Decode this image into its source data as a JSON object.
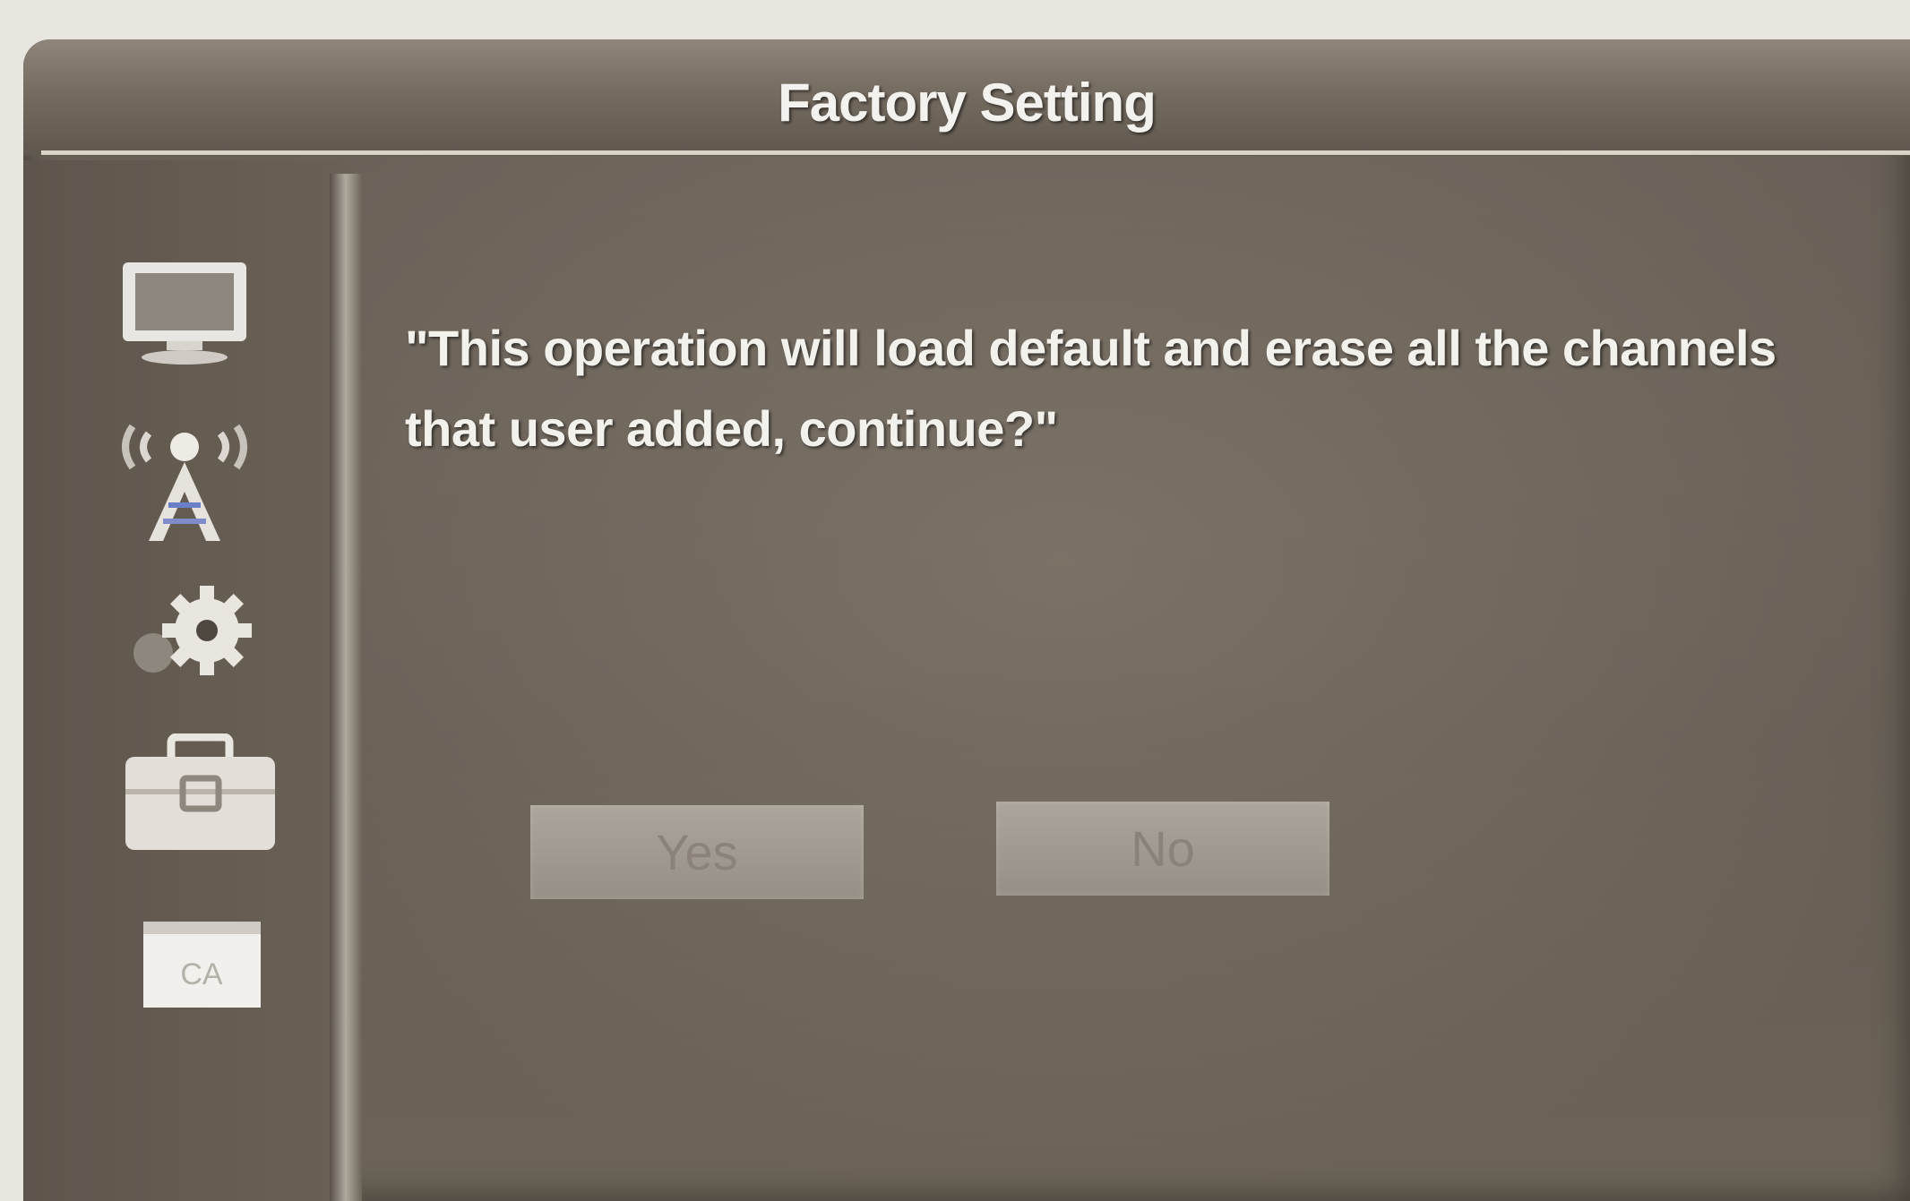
{
  "window": {
    "title": "Factory Setting"
  },
  "sidebar": {
    "items": [
      {
        "icon": "tv-icon"
      },
      {
        "icon": "antenna-icon"
      },
      {
        "icon": "gear-icon"
      },
      {
        "icon": "toolbox-icon"
      },
      {
        "icon": "ca-icon",
        "label": "CA"
      }
    ]
  },
  "dialog": {
    "message": "\"This operation will load default and erase all the channels that user added, continue?\"",
    "yes_label": "Yes",
    "no_label": "No"
  }
}
